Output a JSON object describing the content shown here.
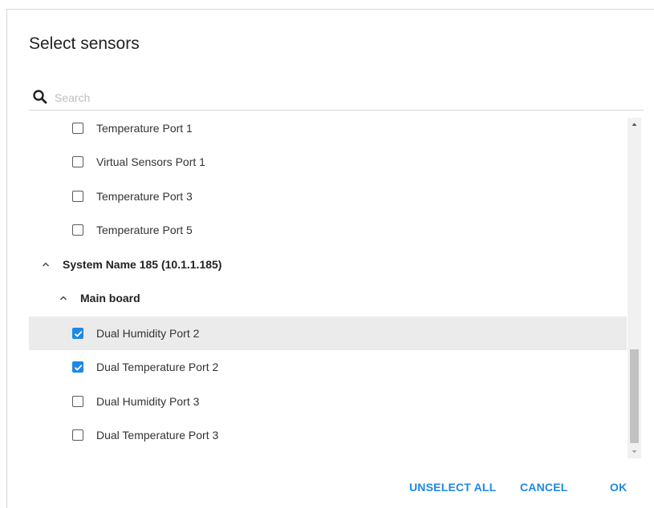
{
  "dialog": {
    "title": "Select sensors"
  },
  "search": {
    "placeholder": "Search",
    "value": ""
  },
  "list": [
    {
      "type": "sensor",
      "label": "Temperature Port 1",
      "checked": false
    },
    {
      "type": "sensor",
      "label": "Virtual Sensors Port 1",
      "checked": false
    },
    {
      "type": "sensor",
      "label": "Temperature Port 3",
      "checked": false
    },
    {
      "type": "sensor",
      "label": "Temperature Port 5",
      "checked": false
    },
    {
      "type": "system",
      "label": "System Name 185 (10.1.1.185)",
      "expanded": true
    },
    {
      "type": "board",
      "label": "Main board",
      "expanded": true
    },
    {
      "type": "sensor",
      "label": "Dual Humidity Port 2",
      "checked": true,
      "highlighted": true
    },
    {
      "type": "sensor",
      "label": "Dual Temperature Port 2",
      "checked": true
    },
    {
      "type": "sensor",
      "label": "Dual Humidity Port 3",
      "checked": false
    },
    {
      "type": "sensor",
      "label": "Dual Temperature Port 3",
      "checked": false
    }
  ],
  "actions": {
    "unselect_all": "UNSELECT ALL",
    "cancel": "CANCEL",
    "ok": "OK"
  },
  "colors": {
    "accent": "#1e88e5",
    "highlight_row": "#ebebeb"
  },
  "icons": {
    "search": "search-icon",
    "expand": "chevron-up-icon",
    "checked": "check-icon"
  }
}
